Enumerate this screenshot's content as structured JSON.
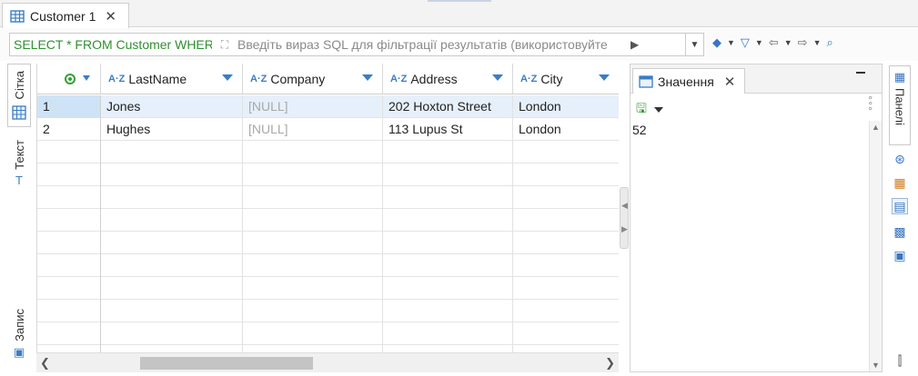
{
  "tab": {
    "title": "Customer 1",
    "icon": "table-icon"
  },
  "filter": {
    "sql": "SELECT * FROM Customer WHER",
    "placeholder": "Введіть вираз SQL для фільтрації результатів (використовуйте"
  },
  "left_tabs": {
    "grid": "Сітка",
    "text": "Текст",
    "record": "Запис"
  },
  "columns": [
    "LastName",
    "Company",
    "Address",
    "City"
  ],
  "rows": [
    {
      "num": "1",
      "LastName": "Jones",
      "Company": "[NULL]",
      "Address": "202 Hoxton Street",
      "City": "London"
    },
    {
      "num": "2",
      "LastName": "Hughes",
      "Company": "[NULL]",
      "Address": "113 Lupus St",
      "City": "London"
    }
  ],
  "value_panel": {
    "tab_title": "Значення",
    "value": "52"
  },
  "right_panel": {
    "label": "Панелі"
  },
  "colors": {
    "accent": "#3b7dc4",
    "sql_green": "#2f8f2f",
    "selected_row": "#e6f0fb",
    "null_gray": "#a8a8a8"
  }
}
